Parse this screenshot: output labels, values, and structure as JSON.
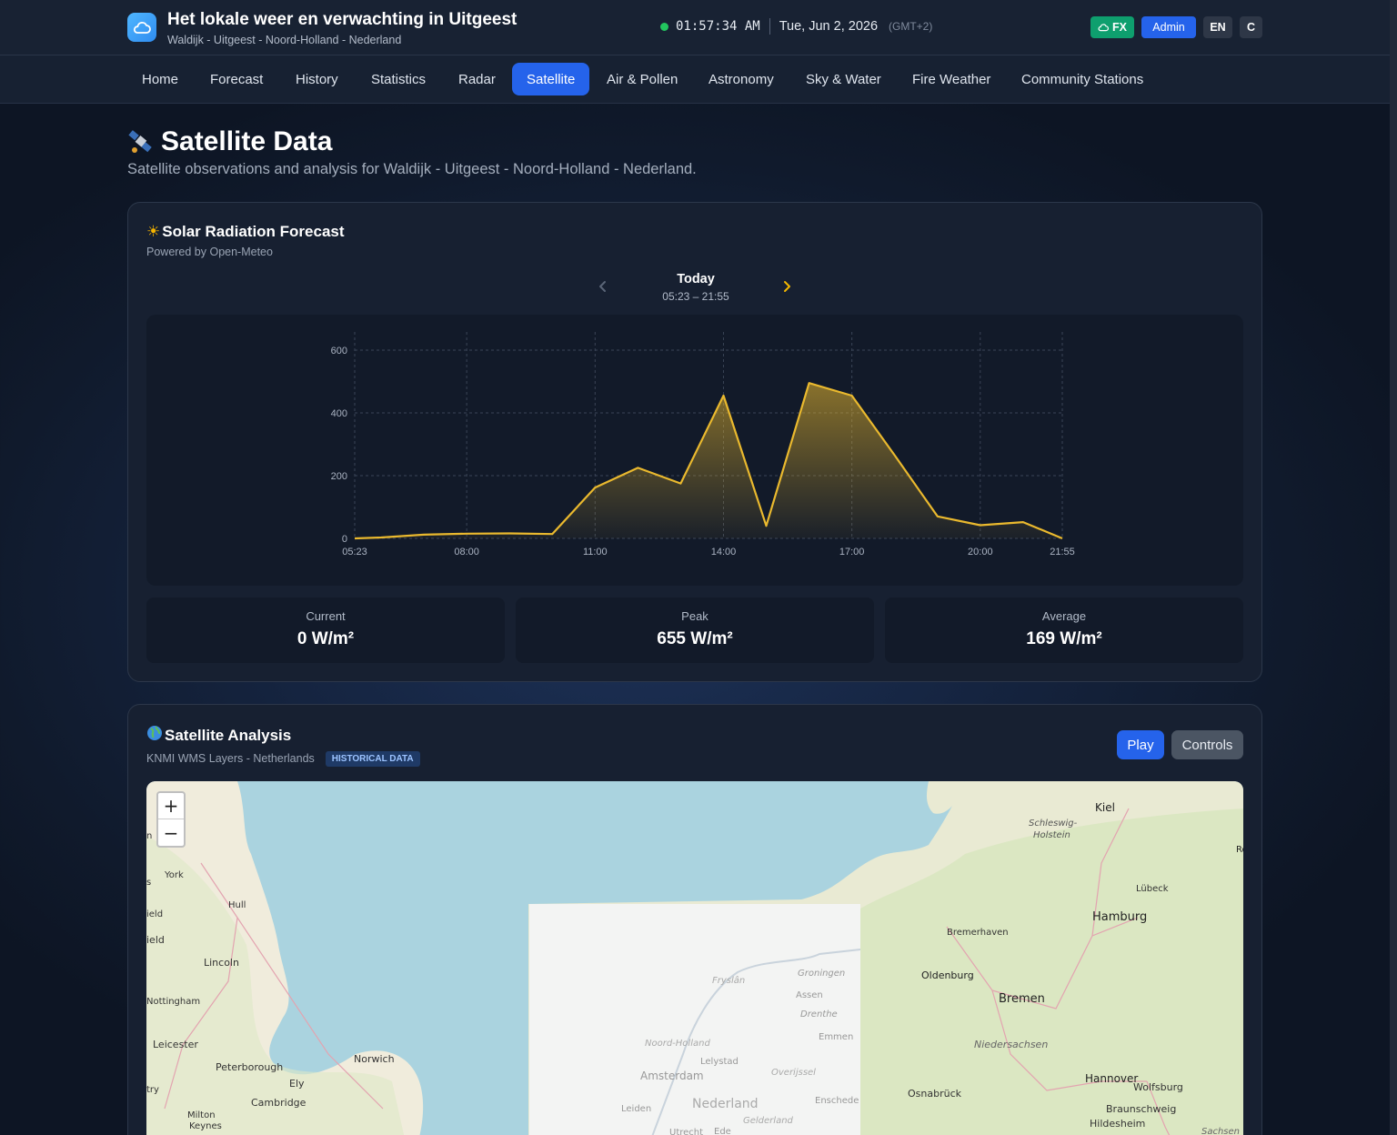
{
  "header": {
    "title": "Het lokale weer en verwachting in Uitgeest",
    "subtitle": "Waldijk - Uitgeest - Noord-Holland - Nederland",
    "time": "01:57:34 AM",
    "date": "Tue, Jun 2, 2026",
    "timezone": "(GMT+2)",
    "fx_label": "FX",
    "admin_label": "Admin",
    "lang_label": "EN",
    "unit_label": "C",
    "status_color": "#22c55e"
  },
  "nav": {
    "items": [
      {
        "label": "Home"
      },
      {
        "label": "Forecast"
      },
      {
        "label": "History"
      },
      {
        "label": "Statistics"
      },
      {
        "label": "Radar"
      },
      {
        "label": "Satellite",
        "active": true
      },
      {
        "label": "Air & Pollen"
      },
      {
        "label": "Astronomy"
      },
      {
        "label": "Sky & Water"
      },
      {
        "label": "Fire Weather"
      },
      {
        "label": "Community Stations"
      }
    ]
  },
  "page": {
    "icon": "satellite-icon",
    "title": "Satellite Data",
    "subtitle": "Satellite observations and analysis for Waldijk - Uitgeest - Noord-Holland - Nederland."
  },
  "solar": {
    "icon": "sun-icon",
    "title": "Solar Radiation Forecast",
    "subtitle": "Powered by Open-Meteo",
    "day_label": "Today",
    "day_range": "05:23 – 21:55",
    "stats": {
      "current_label": "Current",
      "current_value": "0 W/m²",
      "peak_label": "Peak",
      "peak_value": "655 W/m²",
      "average_label": "Average",
      "average_value": "169 W/m²"
    }
  },
  "chart_data": {
    "type": "area",
    "x": [
      "05:23",
      "06:00",
      "07:00",
      "08:00",
      "09:00",
      "10:00",
      "11:00",
      "12:00",
      "13:00",
      "14:00",
      "15:00",
      "16:00",
      "17:00",
      "18:00",
      "19:00",
      "20:00",
      "21:00",
      "21:55"
    ],
    "values": [
      0,
      3,
      12,
      15,
      16,
      14,
      162,
      225,
      175,
      455,
      40,
      495,
      455,
      265,
      70,
      42,
      52,
      0
    ],
    "xticks": [
      "05:23",
      "08:00",
      "11:00",
      "14:00",
      "17:00",
      "20:00",
      "21:55"
    ],
    "yticks": [
      0,
      200,
      400,
      600
    ],
    "ylim": [
      0,
      600
    ],
    "grid": true,
    "line_color": "#eab92e",
    "title": "",
    "xlabel": "",
    "ylabel": ""
  },
  "satellite": {
    "icon": "globe-icon",
    "title": "Satellite Analysis",
    "subtitle": "KNMI WMS Layers - Netherlands",
    "badge": "HISTORICAL DATA",
    "play_label": "Play",
    "controls_label": "Controls",
    "zoom_in": "+",
    "zoom_out": "−",
    "map_labels": [
      "Kiel",
      "Schleswig-",
      "Holstein",
      "Ro",
      "Lübeck",
      "Hamburg",
      "Bremerhaven",
      "Oldenburg",
      "Bremen",
      "Niedersachsen",
      "Hannover",
      "Wolfsburg",
      "Braunschweig",
      "Osnabrück",
      "Hildesheim",
      "Sachsen",
      "York",
      "Hull",
      "Lincoln",
      "Nottingham",
      "Leicester",
      "Peterborough",
      "Norwich",
      "Ely",
      "Cambridge",
      "Milton",
      "Keynes",
      "Groningen",
      "Assen",
      "Drenthe",
      "Emmen",
      "Fryslân",
      "Noord-Holland",
      "Lelystad",
      "Amsterdam",
      "Nederland",
      "Leiden",
      "Overijssel",
      "Enschede",
      "Gelderland",
      "Utrecht",
      "Ede",
      "ield",
      "ield",
      "try",
      "n",
      "s"
    ]
  }
}
